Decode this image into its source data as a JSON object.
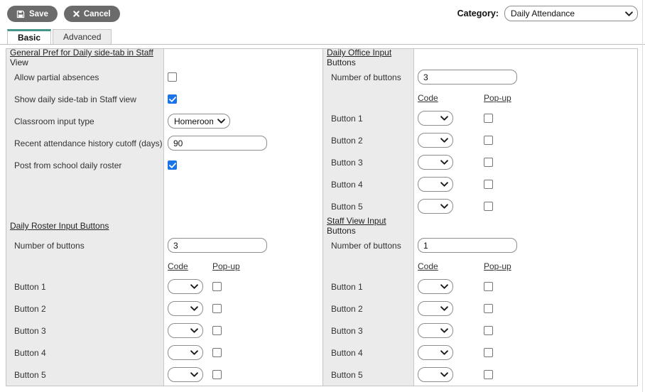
{
  "toolbar": {
    "save_label": "Save",
    "cancel_label": "Cancel"
  },
  "category": {
    "label": "Category:",
    "value": "Daily Attendance"
  },
  "tabs": {
    "basic": "Basic",
    "advanced": "Advanced"
  },
  "colors": {
    "accent_teal": "#459889",
    "button_gray": "#6b6b6b",
    "checkbox_checked_blue": "#1a73e8",
    "label_column_bg": "#ebebeb"
  },
  "panels": {
    "general": {
      "title": "General Pref for Daily side-tab in Staff View",
      "rows": [
        {
          "label": "Allow partial absences",
          "control": "checkbox",
          "checked": false
        },
        {
          "label": "Show daily side-tab in Staff view",
          "control": "checkbox",
          "checked": true
        },
        {
          "label": "Classroom input type",
          "control": "select",
          "value": "Homeroom"
        },
        {
          "label": "Recent attendance history cutoff (days)",
          "control": "text",
          "value": "90"
        },
        {
          "label": "Post from school daily roster",
          "control": "checkbox",
          "checked": true
        }
      ]
    },
    "daily_roster": {
      "title": "Daily Roster Input Buttons",
      "number_label": "Number of buttons",
      "number_value": "3",
      "code_header": "Code",
      "popup_header": "Pop-up",
      "button_labels": [
        "Button 1",
        "Button 2",
        "Button 3",
        "Button 4",
        "Button 5"
      ],
      "code_value": "",
      "popup_checked": false
    },
    "daily_office": {
      "title": "Daily Office Input Buttons",
      "number_label": "Number of buttons",
      "number_value": "3",
      "code_header": "Code",
      "popup_header": "Pop-up",
      "button_labels": [
        "Button 1",
        "Button 2",
        "Button 3",
        "Button 4",
        "Button 5"
      ],
      "code_value": "",
      "popup_checked": false
    },
    "staff_view": {
      "title": "Staff View Input Buttons",
      "number_label": "Number of buttons",
      "number_value": "1",
      "code_header": "Code",
      "popup_header": "Pop-up",
      "button_labels": [
        "Button 1",
        "Button 2",
        "Button 3",
        "Button 4",
        "Button 5"
      ],
      "code_value": "",
      "popup_checked": false
    }
  }
}
